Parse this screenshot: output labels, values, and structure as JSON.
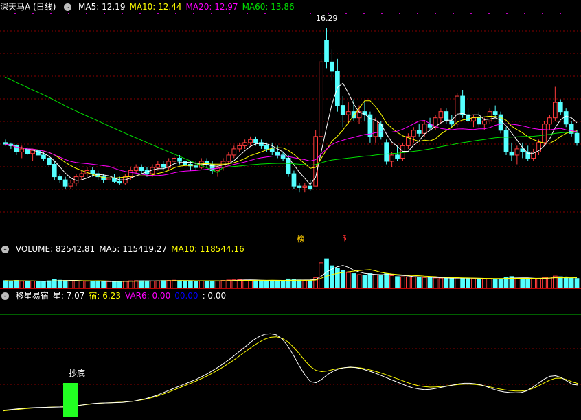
{
  "main": {
    "stock_label": "深天马A (日线)",
    "ma": [
      {
        "label": "MA5: 12.19",
        "color": "#ffffff"
      },
      {
        "label": "MA10: 12.44",
        "color": "#ffff00"
      },
      {
        "label": "MA20: 12.97",
        "color": "#ff00ff"
      },
      {
        "label": "MA60: 13.86",
        "color": "#00e000"
      }
    ],
    "high_label": "16.29",
    "marker_a": "榜",
    "marker_b": "$"
  },
  "volume": {
    "labels": [
      {
        "label": "VOLUME: 82542.81",
        "color": "#ffffff"
      },
      {
        "label": "MA5: 115419.27",
        "color": "#ffffff"
      },
      {
        "label": "MA10: 118544.16",
        "color": "#ffff00"
      }
    ]
  },
  "indicator": {
    "labels": [
      {
        "label": "移星易宿",
        "color": "#ffffff"
      },
      {
        "label": "星: 7.07",
        "color": "#ffffff"
      },
      {
        "label": "宿: 6.23",
        "color": "#ffff00"
      },
      {
        "label": "VAR6: 0.00",
        "color": "#ff00ff"
      },
      {
        "label": "00.00",
        "color": "#0000ff"
      },
      {
        "label": ": 0.00",
        "color": "#ffffff"
      }
    ],
    "signal_text": "抄底"
  },
  "colors": {
    "up": "#ff3c3c",
    "down": "#54ffff",
    "grid": "#8a0000",
    "separator": "#c00000",
    "signal": "#22ff22"
  },
  "chart_data": {
    "type": "candlestick",
    "price_range": [
      9.5,
      16.8
    ],
    "candles": [
      [
        12.6,
        12.7,
        12.5,
        12.55
      ],
      [
        12.55,
        12.6,
        12.4,
        12.5
      ],
      [
        12.5,
        12.55,
        12.2,
        12.3
      ],
      [
        12.3,
        12.5,
        12.1,
        12.4
      ],
      [
        12.4,
        12.45,
        12.2,
        12.25
      ],
      [
        12.25,
        12.4,
        12.0,
        12.35
      ],
      [
        12.35,
        12.4,
        12.1,
        12.2
      ],
      [
        12.2,
        12.3,
        12.0,
        12.1
      ],
      [
        12.1,
        12.2,
        11.8,
        11.9
      ],
      [
        11.9,
        12.0,
        11.4,
        11.5
      ],
      [
        11.5,
        11.6,
        11.3,
        11.4
      ],
      [
        11.4,
        11.5,
        11.1,
        11.2
      ],
      [
        11.2,
        11.4,
        11.1,
        11.3
      ],
      [
        11.3,
        11.6,
        11.2,
        11.5
      ],
      [
        11.5,
        11.7,
        11.4,
        11.6
      ],
      [
        11.6,
        11.8,
        11.5,
        11.7
      ],
      [
        11.7,
        11.8,
        11.5,
        11.6
      ],
      [
        11.6,
        11.7,
        11.4,
        11.5
      ],
      [
        11.5,
        11.6,
        11.3,
        11.4
      ],
      [
        11.4,
        11.5,
        11.3,
        11.45
      ],
      [
        11.45,
        11.6,
        11.3,
        11.35
      ],
      [
        11.35,
        11.5,
        11.25,
        11.3
      ],
      [
        11.3,
        11.6,
        11.25,
        11.5
      ],
      [
        11.5,
        11.8,
        11.4,
        11.7
      ],
      [
        11.7,
        11.9,
        11.6,
        11.8
      ],
      [
        11.8,
        11.9,
        11.6,
        11.7
      ],
      [
        11.7,
        11.8,
        11.5,
        11.6
      ],
      [
        11.6,
        11.9,
        11.5,
        11.8
      ],
      [
        11.8,
        12.0,
        11.7,
        11.9
      ],
      [
        11.9,
        12.0,
        11.7,
        11.8
      ],
      [
        11.8,
        12.1,
        11.7,
        12.0
      ],
      [
        12.0,
        12.2,
        11.9,
        12.1
      ],
      [
        12.1,
        12.2,
        11.9,
        12.0
      ],
      [
        12.0,
        12.1,
        11.8,
        11.9
      ],
      [
        11.9,
        12.0,
        11.7,
        11.85
      ],
      [
        11.85,
        12.0,
        11.7,
        11.8
      ],
      [
        11.8,
        12.1,
        11.75,
        12.0
      ],
      [
        12.0,
        12.1,
        11.8,
        11.9
      ],
      [
        11.9,
        12.0,
        11.6,
        11.7
      ],
      [
        11.7,
        11.9,
        11.5,
        11.8
      ],
      [
        11.8,
        12.1,
        11.7,
        12.0
      ],
      [
        12.0,
        12.3,
        11.9,
        12.2
      ],
      [
        12.2,
        12.5,
        12.1,
        12.4
      ],
      [
        12.4,
        12.6,
        12.3,
        12.5
      ],
      [
        12.5,
        12.7,
        12.4,
        12.6
      ],
      [
        12.6,
        12.8,
        12.5,
        12.7
      ],
      [
        12.7,
        12.8,
        12.5,
        12.6
      ],
      [
        12.6,
        12.7,
        12.4,
        12.5
      ],
      [
        12.5,
        12.6,
        12.3,
        12.4
      ],
      [
        12.4,
        12.6,
        12.2,
        12.3
      ],
      [
        12.3,
        12.5,
        12.1,
        12.2
      ],
      [
        12.2,
        12.3,
        12.0,
        12.1
      ],
      [
        12.1,
        12.2,
        11.5,
        11.6
      ],
      [
        11.6,
        11.7,
        11.1,
        11.2
      ],
      [
        11.2,
        11.3,
        11.0,
        11.15
      ],
      [
        11.15,
        11.3,
        11.0,
        11.2
      ],
      [
        11.2,
        11.4,
        11.05,
        11.1
      ],
      [
        11.2,
        13.0,
        11.2,
        12.8
      ],
      [
        12.8,
        15.3,
        12.6,
        15.2
      ],
      [
        15.9,
        16.29,
        15.0,
        15.2
      ],
      [
        15.2,
        15.6,
        14.6,
        14.9
      ],
      [
        14.9,
        15.3,
        13.6,
        13.8
      ],
      [
        13.8,
        14.1,
        13.1,
        13.5
      ],
      [
        13.5,
        13.9,
        13.2,
        13.6
      ],
      [
        13.6,
        14.0,
        13.3,
        13.4
      ],
      [
        13.4,
        13.8,
        13.2,
        13.6
      ],
      [
        13.6,
        13.9,
        13.3,
        13.5
      ],
      [
        13.5,
        13.6,
        12.6,
        12.8
      ],
      [
        12.8,
        13.4,
        12.6,
        13.3
      ],
      [
        13.2,
        13.3,
        12.7,
        12.8
      ],
      [
        12.6,
        12.7,
        11.9,
        12.0
      ],
      [
        12.0,
        12.3,
        11.8,
        12.2
      ],
      [
        12.2,
        12.5,
        12.0,
        12.1
      ],
      [
        12.1,
        12.6,
        12.0,
        12.5
      ],
      [
        12.5,
        12.9,
        12.4,
        12.8
      ],
      [
        12.8,
        13.1,
        12.6,
        13.0
      ],
      [
        13.0,
        13.2,
        12.8,
        12.9
      ],
      [
        12.9,
        13.3,
        12.8,
        13.2
      ],
      [
        13.2,
        13.4,
        13.0,
        13.1
      ],
      [
        13.1,
        13.5,
        13.0,
        13.4
      ],
      [
        13.4,
        13.7,
        13.2,
        13.6
      ],
      [
        13.6,
        13.7,
        13.2,
        13.3
      ],
      [
        13.3,
        13.5,
        13.1,
        13.2
      ],
      [
        13.2,
        14.2,
        13.1,
        14.1
      ],
      [
        14.1,
        14.3,
        13.4,
        13.5
      ],
      [
        13.5,
        13.7,
        13.2,
        13.3
      ],
      [
        13.3,
        13.5,
        13.1,
        13.4
      ],
      [
        13.4,
        13.6,
        13.1,
        13.2
      ],
      [
        13.2,
        13.4,
        13.0,
        13.3
      ],
      [
        13.3,
        13.7,
        13.2,
        13.6
      ],
      [
        13.6,
        13.8,
        13.4,
        13.5
      ],
      [
        13.5,
        13.6,
        12.9,
        13.0
      ],
      [
        13.0,
        13.1,
        12.2,
        12.3
      ],
      [
        12.3,
        12.6,
        12.0,
        12.2
      ],
      [
        12.2,
        12.5,
        11.9,
        12.4
      ],
      [
        12.4,
        12.6,
        12.1,
        12.3
      ],
      [
        12.3,
        12.5,
        12.0,
        12.1
      ],
      [
        12.1,
        12.4,
        12.0,
        12.3
      ],
      [
        12.3,
        12.7,
        12.2,
        12.6
      ],
      [
        12.6,
        13.3,
        12.5,
        13.2
      ],
      [
        13.2,
        13.5,
        13.0,
        13.4
      ],
      [
        13.4,
        14.4,
        13.3,
        13.9
      ],
      [
        13.9,
        14.0,
        13.5,
        13.6
      ],
      [
        13.6,
        13.7,
        13.1,
        13.2
      ],
      [
        13.2,
        13.3,
        12.8,
        12.9
      ],
      [
        12.9,
        13.0,
        12.5,
        12.6
      ]
    ],
    "volume_range": [
      0,
      350000
    ],
    "volume": [
      78000,
      75000,
      80000,
      72000,
      70000,
      74000,
      71000,
      69000,
      76000,
      90000,
      82000,
      80000,
      74000,
      78000,
      75000,
      72000,
      70000,
      71000,
      69000,
      68000,
      70000,
      72000,
      74000,
      76000,
      78000,
      77000,
      75000,
      73000,
      76000,
      79000,
      80000,
      82000,
      78000,
      76000,
      75000,
      74000,
      77000,
      76000,
      75000,
      73000,
      80000,
      84000,
      86000,
      88000,
      85000,
      83000,
      80000,
      78000,
      76000,
      79000,
      75000,
      74000,
      95000,
      90000,
      85000,
      80000,
      78000,
      110000,
      260000,
      300000,
      230000,
      200000,
      180000,
      160000,
      150000,
      140000,
      130000,
      150000,
      140000,
      135000,
      150000,
      130000,
      120000,
      118000,
      116000,
      115000,
      114000,
      110000,
      108000,
      106000,
      104000,
      102000,
      100000,
      110000,
      105000,
      100000,
      98000,
      96000,
      95000,
      100000,
      98000,
      96000,
      110000,
      120000,
      105000,
      100000,
      98000,
      96000,
      100000,
      110000,
      115000,
      125000,
      118000,
      112000,
      105000,
      100000
    ],
    "indicator_range": [
      0,
      100
    ],
    "star": [
      6,
      6.5,
      7,
      7.5,
      8,
      8.3,
      8.5,
      8.6,
      8.7,
      8.8,
      8.9,
      9,
      9.5,
      10,
      10.8,
      11.5,
      12,
      12.3,
      12.5,
      12.6,
      12.8,
      13,
      13.5,
      14,
      15,
      16,
      17.5,
      19,
      21,
      23,
      25,
      27,
      29,
      31,
      33,
      35.5,
      38,
      41,
      44,
      47.5,
      51,
      55,
      59,
      63,
      67,
      70,
      72,
      72.5,
      71.5,
      68,
      62,
      54,
      45,
      37,
      31,
      30,
      33,
      37,
      40,
      42,
      43,
      43.5,
      43,
      42,
      40.5,
      39,
      37,
      35,
      33,
      31,
      29,
      27,
      25.5,
      24.5,
      24,
      24.2,
      25,
      26,
      27,
      28,
      29,
      29.5,
      29.5,
      29,
      28,
      26.5,
      24.5,
      23,
      22,
      21.5,
      21.3,
      21.5,
      23,
      26,
      29.5,
      33,
      35.5,
      36,
      34.5,
      31.5,
      28.5,
      28
    ],
    "host": [
      5.5,
      6,
      6.5,
      7,
      7.5,
      7.9,
      8.2,
      8.5,
      8.7,
      8.9,
      9,
      9.2,
      9.6,
      10.1,
      10.7,
      11.3,
      11.8,
      12.2,
      12.5,
      12.7,
      12.9,
      13.1,
      13.5,
      14,
      14.8,
      15.6,
      16.8,
      18.2,
      19.8,
      21.6,
      23.6,
      25.6,
      27.6,
      29.6,
      31.6,
      33.8,
      36.2,
      38.8,
      41.6,
      44.6,
      47.8,
      51.2,
      54.8,
      58.4,
      62,
      65.2,
      67.8,
      69.4,
      69.8,
      68.6,
      65.6,
      61,
      55.4,
      49.4,
      44,
      40.6,
      39.6,
      40.2,
      41.4,
      42.4,
      43,
      43.3,
      43.2,
      42.6,
      41.6,
      40.4,
      39,
      37.4,
      35.6,
      33.8,
      32,
      30.2,
      28.6,
      27.4,
      26.6,
      26.2,
      26.3,
      26.7,
      27.3,
      27.9,
      28.4,
      28.7,
      28.7,
      28.4,
      27.8,
      26.9,
      25.8,
      24.7,
      23.8,
      23.2,
      22.8,
      22.8,
      23.4,
      25,
      27.2,
      29.8,
      32.2,
      33.8,
      33.9,
      32.6,
      30.6,
      29.2
    ]
  }
}
